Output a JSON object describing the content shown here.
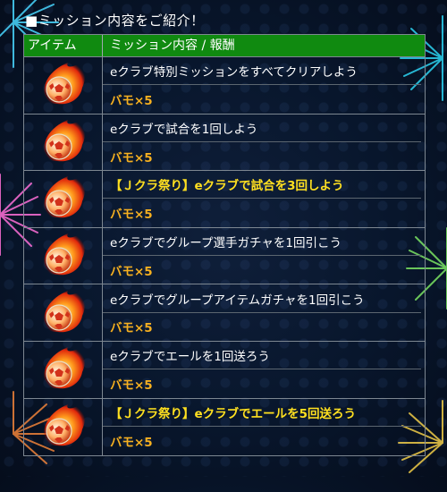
{
  "header": {
    "title": "■ミッション内容をご紹介！"
  },
  "table": {
    "col_item": "アイテム",
    "col_mission": "ミッション内容 / 報酬"
  },
  "missions": [
    {
      "text": "eクラブ特別ミッションをすべてクリアしよう",
      "reward": "バモ×5",
      "highlight": false
    },
    {
      "text": "eクラブで試合を1回しよう",
      "reward": "バモ×5",
      "highlight": false
    },
    {
      "text": "【Ｊクラ祭り】eクラブで試合を3回しよう",
      "reward": "バモ×5",
      "highlight": true
    },
    {
      "text": "eクラブでグループ選手ガチャを1回引こう",
      "reward": "バモ×5",
      "highlight": false
    },
    {
      "text": "eクラブでグループアイテムガチャを1回引こう",
      "reward": "バモ×5",
      "highlight": false
    },
    {
      "text": "eクラブでエールを1回送ろう",
      "reward": "バモ×5",
      "highlight": false
    },
    {
      "text": "【Ｊクラ祭り】eクラブでエールを5回送ろう",
      "reward": "バモ×5",
      "highlight": true
    }
  ],
  "colors": {
    "header_green": "#108a10",
    "reward_orange": "#f6b020",
    "event_yellow": "#ffe020",
    "background": "#08162c"
  },
  "icons": {
    "item": "flaming-soccer-ball-icon"
  }
}
